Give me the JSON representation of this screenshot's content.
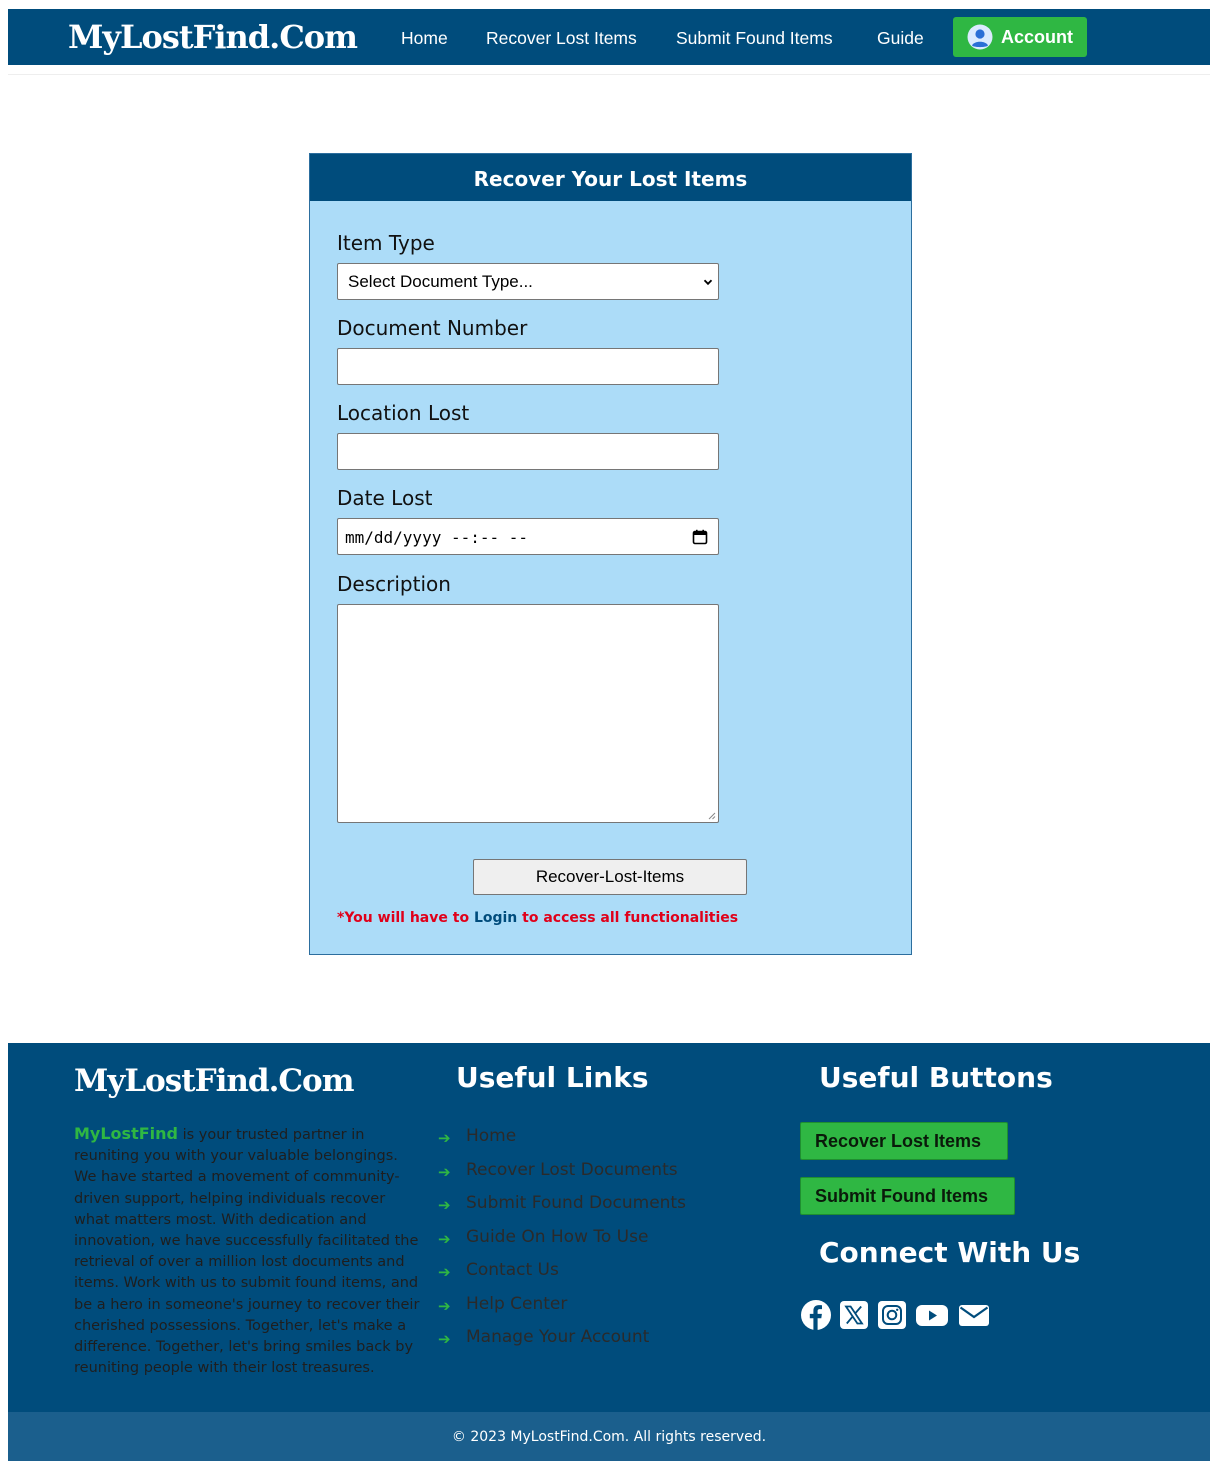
{
  "navbar": {
    "brand": "MyLostFind.Com",
    "links": [
      "Home",
      "Recover Lost Items",
      "Submit Found Items",
      "Guide"
    ],
    "account_label": "Account",
    "account_icon": "user-circle-icon"
  },
  "form": {
    "title": "Recover Your Lost Items",
    "item_type_label": "Item Type",
    "item_type_selected": "Select Document Type...",
    "document_number_label": "Document Number",
    "document_number_value": "",
    "location_label": "Location Lost",
    "location_value": "",
    "date_label": "Date Lost",
    "date_placeholder": "mm/dd/yyyy --:-- --",
    "description_label": "Description",
    "description_value": "",
    "submit_label": "Recover-Lost-Items",
    "notice_prefix": "*You will have to",
    "notice_link": "Login",
    "notice_suffix": "to access all functionalities"
  },
  "footer": {
    "brand": "MyLostFind.Com",
    "about_brand": "MyLostFind",
    "about_text": " is your trusted partner in reuniting you with your valuable belongings. We have started a movement of community-driven support, helping individuals recover what matters most. With dedication and innovation, we have successfully facilitated the retrieval of over a million lost documents and items. Work with us to submit found items, and be a hero in someone's journey to recover their cherished possessions. Together, let's make a difference. Together, let's bring smiles back by reuniting people with their lost treasures.",
    "links_heading": "Useful Links",
    "links": [
      "Home",
      "Recover Lost Documents",
      "Submit Found Documents",
      "Guide On How To Use",
      "Contact Us",
      "Help Center",
      "Manage Your Account"
    ],
    "buttons_heading": "Useful Buttons",
    "button_recover": "Recover Lost Items",
    "button_submit": "Submit Found Items",
    "connect_heading": "Connect With Us",
    "social_icons": [
      "facebook-icon",
      "x-twitter-icon",
      "instagram-icon",
      "youtube-icon",
      "email-icon"
    ],
    "copyright": "© 2023 MyLostFind.Com. All rights reserved."
  },
  "colors": {
    "primary": "#004c7c",
    "accent": "#2fb743",
    "form_bg": "#acdcf8",
    "notice": "#e0001a"
  }
}
